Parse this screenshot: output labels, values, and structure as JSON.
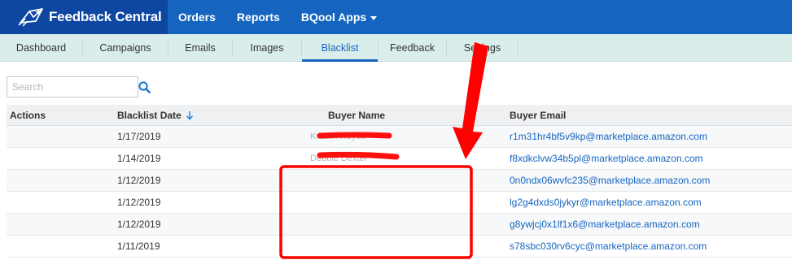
{
  "topnav": {
    "brand": "Feedback Central",
    "items": [
      {
        "label": "Orders"
      },
      {
        "label": "Reports"
      },
      {
        "label": "BQool Apps"
      }
    ]
  },
  "subnav": {
    "tabs": [
      {
        "label": "Dashboard",
        "active": false
      },
      {
        "label": "Campaigns",
        "active": false
      },
      {
        "label": "Emails",
        "active": false
      },
      {
        "label": "Images",
        "active": false
      },
      {
        "label": "Blacklist",
        "active": true
      },
      {
        "label": "Feedback",
        "active": false
      },
      {
        "label": "Settings",
        "active": false
      }
    ]
  },
  "search": {
    "placeholder": "Search",
    "value": ""
  },
  "table": {
    "headers": {
      "actions": "Actions",
      "date": "Blacklist Date",
      "name": "Buyer Name",
      "email": "Buyer Email"
    },
    "sort": {
      "column": "date",
      "direction": "descending"
    },
    "rows": [
      {
        "actions": "",
        "date": "1/17/2019",
        "name": "Kristen Keyes",
        "email": "r1m31hr4bf5v9kp@marketplace.amazon.com"
      },
      {
        "actions": "",
        "date": "1/14/2019",
        "name": "Debbie Dexter",
        "email": "f8xdkclvw34b5pl@marketplace.amazon.com"
      },
      {
        "actions": "",
        "date": "1/12/2019",
        "name": "",
        "email": "0n0ndx06wvfc235@marketplace.amazon.com"
      },
      {
        "actions": "",
        "date": "1/12/2019",
        "name": "",
        "email": "lg2g4dxds0jykyr@marketplace.amazon.com"
      },
      {
        "actions": "",
        "date": "1/12/2019",
        "name": "",
        "email": "g8ywjcj0x1lf1x6@marketplace.amazon.com"
      },
      {
        "actions": "",
        "date": "1/11/2019",
        "name": "",
        "email": "s78sbc030rv6cyc@marketplace.amazon.com"
      }
    ]
  },
  "colors": {
    "topnav_bg": "#1565c0",
    "brand_bg": "#0d47a1",
    "subnav_bg": "#d9eeea",
    "link": "#1565c0",
    "annotation_red": "#ff0000"
  }
}
